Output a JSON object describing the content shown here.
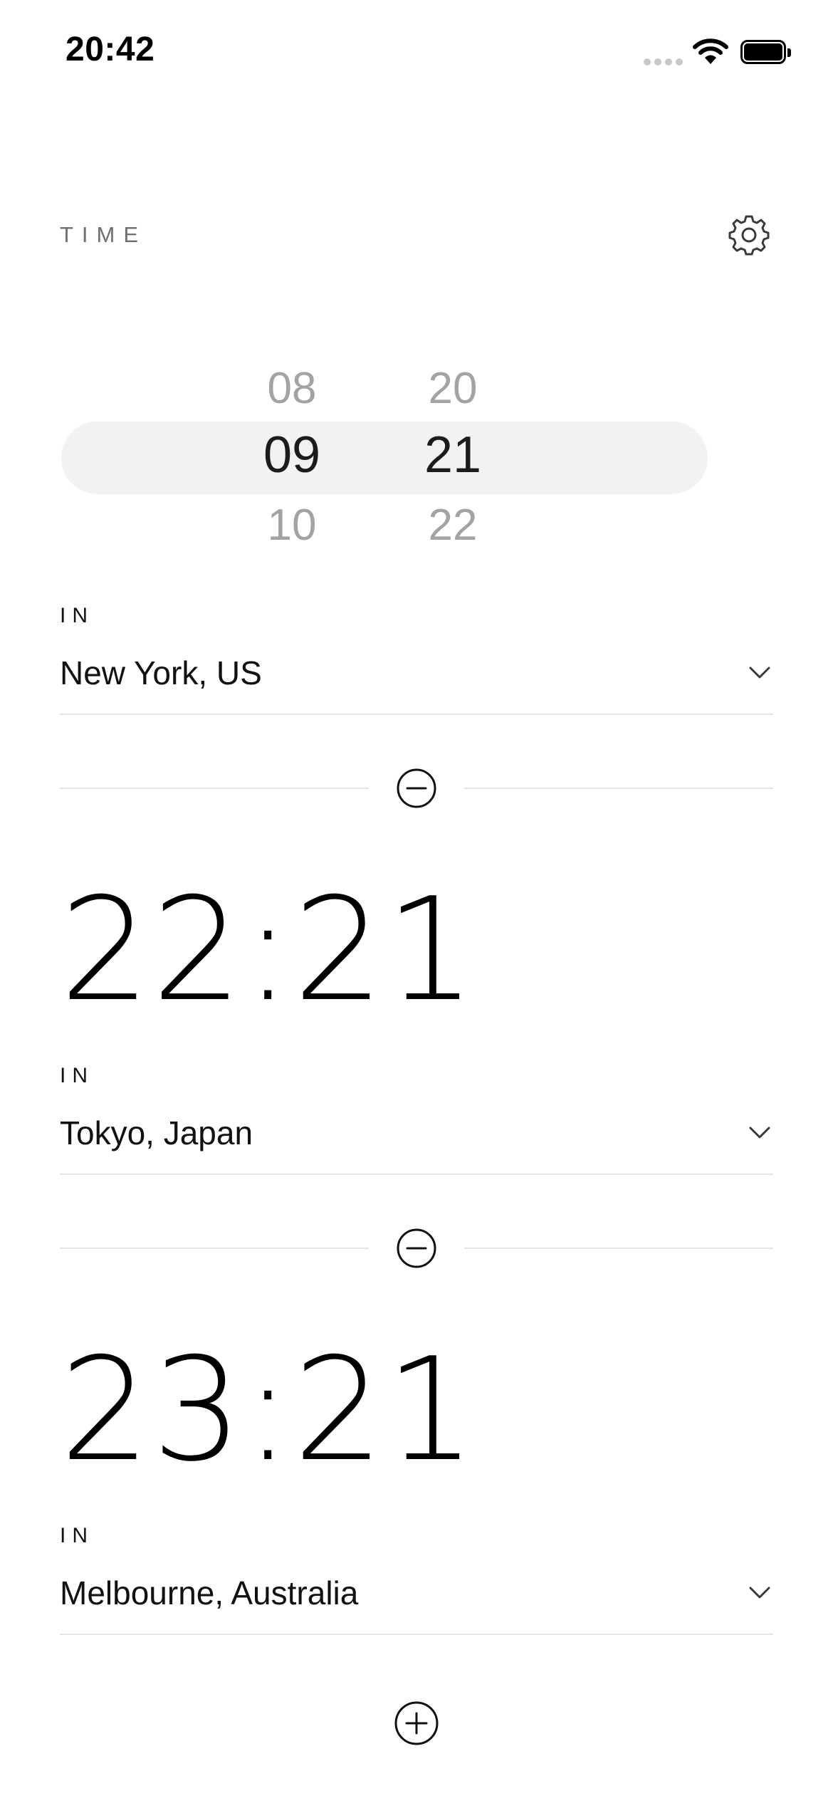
{
  "status_bar": {
    "time": "20:42"
  },
  "header": {
    "title": "TIME",
    "settings_icon": "gear-icon"
  },
  "picker": {
    "hours": [
      "08",
      "09",
      "10"
    ],
    "minutes": [
      "20",
      "21",
      "22"
    ],
    "selected_hour": "09",
    "selected_minute": "21"
  },
  "source": {
    "in_label": "IN",
    "location": "New York, US"
  },
  "conversions": [
    {
      "time": "22:21",
      "in_label": "IN",
      "location": "Tokyo, Japan"
    },
    {
      "time": "23:21",
      "in_label": "IN",
      "location": "Melbourne, Australia"
    }
  ],
  "icons": {
    "remove": "minus-circle-icon",
    "add": "plus-circle-icon",
    "dropdown": "chevron-down-icon"
  },
  "colors": {
    "picker_band": "#f2f2f2",
    "dim_text": "#a3a3a3",
    "divider": "#e4e4e4",
    "header_text": "#6e6e73"
  }
}
